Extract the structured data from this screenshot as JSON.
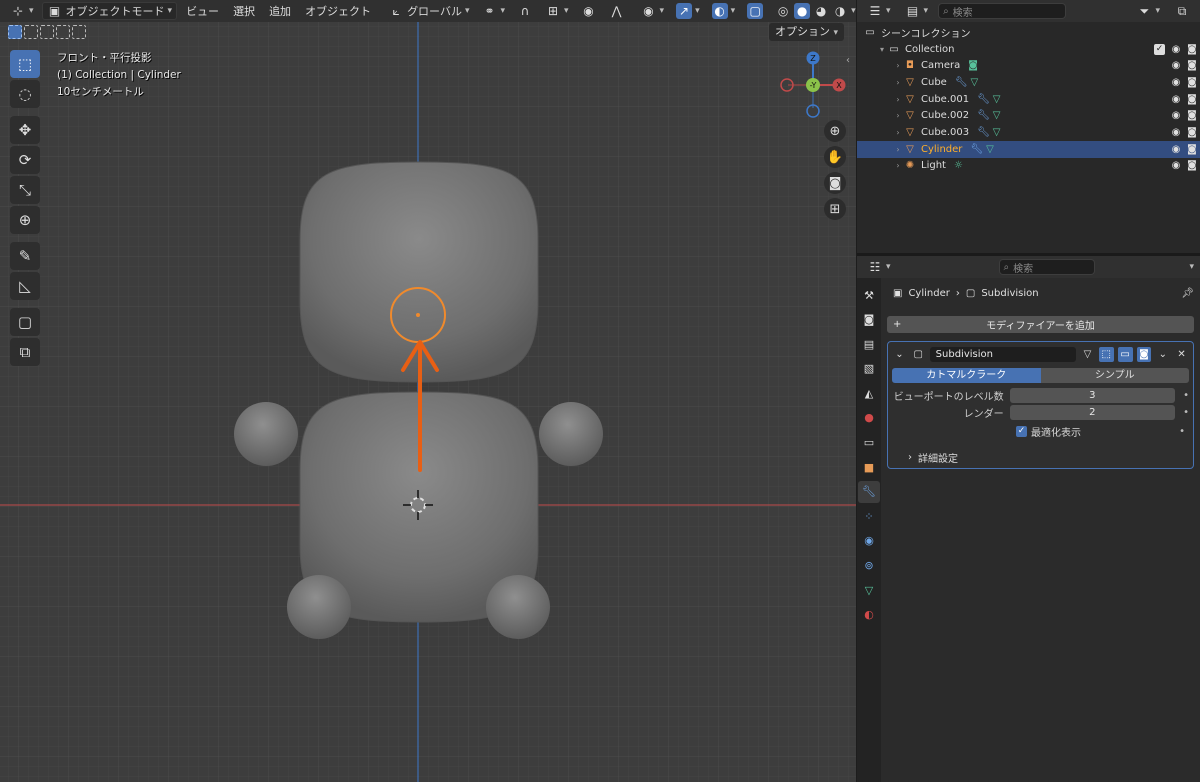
{
  "viewport": {
    "header": {
      "mode_label": "オブジェクトモード",
      "menus": [
        "ビュー",
        "選択",
        "追加",
        "オブジェクト"
      ],
      "transform_orientation": "グローバル"
    },
    "options_label": "オプション",
    "overlay": {
      "view_name": "フロント・平行投影",
      "collection_info": "(1) Collection | Cylinder",
      "scale_info": "10センチメートル"
    },
    "gizmo_axes": {
      "x": "X",
      "y": "-Y",
      "z": "Z"
    },
    "toolbar_icons": [
      "select-box-icon",
      "cursor-icon",
      "move-icon",
      "rotate-icon",
      "scale-icon",
      "transform-icon",
      "annotate-icon",
      "measure-icon",
      "add-cube-icon",
      "add-cube-variant-icon"
    ],
    "colors": {
      "background": "#3d3d3d",
      "x_axis": "#c14a4a",
      "y_axis": "#3d78c9",
      "selection_outline": "#f08a2c",
      "annotation": "#e85f14",
      "mesh": "#777777"
    }
  },
  "outliner": {
    "search_placeholder": "検索",
    "scene_collection_label": "シーンコレクション",
    "collection_label": "Collection",
    "objects": [
      {
        "name": "Camera",
        "type": "camera",
        "selected": false
      },
      {
        "name": "Cube",
        "type": "mesh",
        "selected": false
      },
      {
        "name": "Cube.001",
        "type": "mesh",
        "selected": false
      },
      {
        "name": "Cube.002",
        "type": "mesh",
        "selected": false
      },
      {
        "name": "Cube.003",
        "type": "mesh",
        "selected": false
      },
      {
        "name": "Cylinder",
        "type": "mesh",
        "selected": true
      },
      {
        "name": "Light",
        "type": "light",
        "selected": false
      }
    ]
  },
  "properties": {
    "search_placeholder": "検索",
    "breadcrumb": {
      "object": "Cylinder",
      "modifier": "Subdivision"
    },
    "add_modifier_label": "モディファイアーを追加",
    "modifier": {
      "name": "Subdivision",
      "algorithms": [
        "カトマルクラーク",
        "シンプル"
      ],
      "selected_algorithm": "カトマルクラーク",
      "viewport_levels_label": "ビューポートのレベル数",
      "viewport_levels_value": "3",
      "render_label": "レンダー",
      "render_value": "2",
      "optimal_display_label": "最適化表示",
      "optimal_display_checked": true,
      "advanced_label": "詳細設定"
    }
  }
}
